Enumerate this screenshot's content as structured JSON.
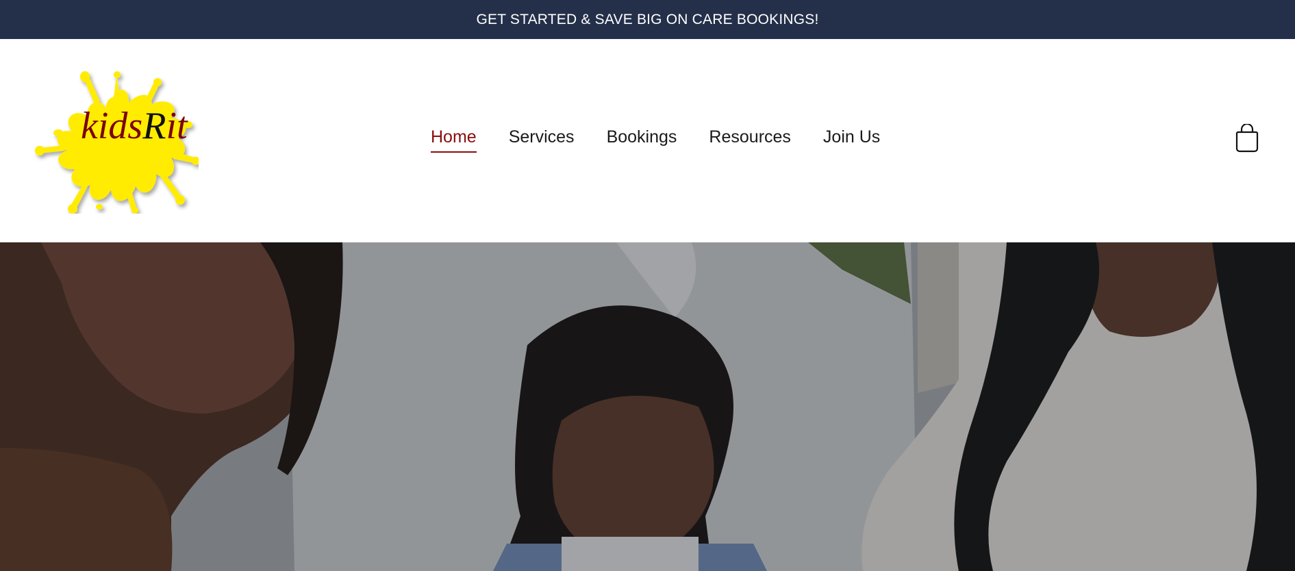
{
  "promo": {
    "text": "GET STARTED & SAVE BIG ON CARE BOOKINGS!"
  },
  "logo": {
    "text_a": "kids",
    "text_b": "R",
    "text_c": "it",
    "splash_color": "#ffec00"
  },
  "nav": {
    "items": [
      {
        "label": "Home",
        "active": true
      },
      {
        "label": "Services",
        "active": false
      },
      {
        "label": "Bookings",
        "active": false
      },
      {
        "label": "Resources",
        "active": false
      },
      {
        "label": "Join Us",
        "active": false
      }
    ]
  },
  "cart": {
    "icon": "shopping-bag-icon"
  },
  "hero": {
    "image": "family-reading-photo"
  },
  "colors": {
    "promo_bg": "#24304a",
    "accent": "#8a0d0d",
    "text": "#1a1a1a"
  }
}
